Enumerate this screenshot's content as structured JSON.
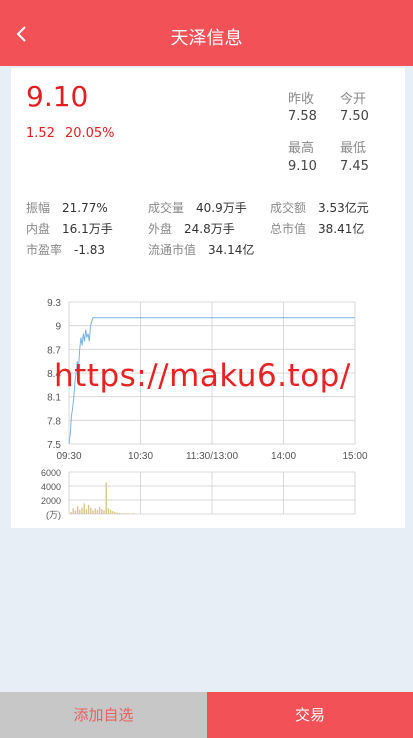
{
  "header": {
    "title": "天泽信息"
  },
  "quote": {
    "price": "9.10",
    "change": "1.52",
    "change_pct": "20.05%",
    "prev_close_label": "昨收",
    "prev_close": "7.58",
    "open_label": "今开",
    "open": "7.50",
    "high_label": "最高",
    "high": "9.10",
    "low_label": "最低",
    "low": "7.45"
  },
  "stats": [
    {
      "label": "振幅",
      "value": "21.77%"
    },
    {
      "label": "成交量",
      "value": "40.9万手"
    },
    {
      "label": "成交额",
      "value": "3.53亿元"
    },
    {
      "label": "内盘",
      "value": "16.1万手"
    },
    {
      "label": "外盘",
      "value": "24.8万手"
    },
    {
      "label": "总市值",
      "value": "38.41亿"
    },
    {
      "label": "市盈率",
      "value": "-1.83"
    },
    {
      "label": "流通市值",
      "value": "34.14亿"
    }
  ],
  "chart_data": {
    "type": "line",
    "y_ticks": [
      "9.3",
      "9",
      "8.7",
      "8.4",
      "8.1",
      "7.8",
      "7.5"
    ],
    "ylim": [
      7.5,
      9.3
    ],
    "x_ticks": [
      "09:30",
      "10:30",
      "11:30/13:00",
      "14:00",
      "15:00"
    ],
    "series": [
      {
        "x": [
          0,
          1,
          2,
          3,
          4,
          5,
          6,
          7,
          8,
          9,
          10,
          11,
          12,
          13,
          14,
          15,
          16,
          17,
          18,
          20,
          25,
          40,
          60,
          90,
          120,
          150,
          180,
          210,
          240
        ],
        "values": [
          7.5,
          7.62,
          7.85,
          7.95,
          8.1,
          8.3,
          8.4,
          8.55,
          8.45,
          8.7,
          8.85,
          8.75,
          8.9,
          8.8,
          8.95,
          8.85,
          8.9,
          8.8,
          9.0,
          9.1,
          9.1,
          9.1,
          9.1,
          9.1,
          9.1,
          9.1,
          9.1,
          9.1,
          9.1
        ]
      }
    ],
    "volume": {
      "y_ticks": [
        "6000",
        "4000",
        "2000",
        "(万)"
      ],
      "ylim": [
        0,
        6000
      ],
      "values": [
        300,
        800,
        500,
        1100,
        600,
        900,
        1500,
        700,
        1300,
        900,
        500,
        800,
        600,
        1000,
        700,
        500,
        4500,
        800,
        600,
        400,
        300,
        200,
        150,
        100,
        80,
        120,
        90,
        60,
        100,
        40
      ]
    }
  },
  "footer": {
    "watch_label": "添加自选",
    "trade_label": "交易"
  },
  "watermark": "https://maku6.top/"
}
